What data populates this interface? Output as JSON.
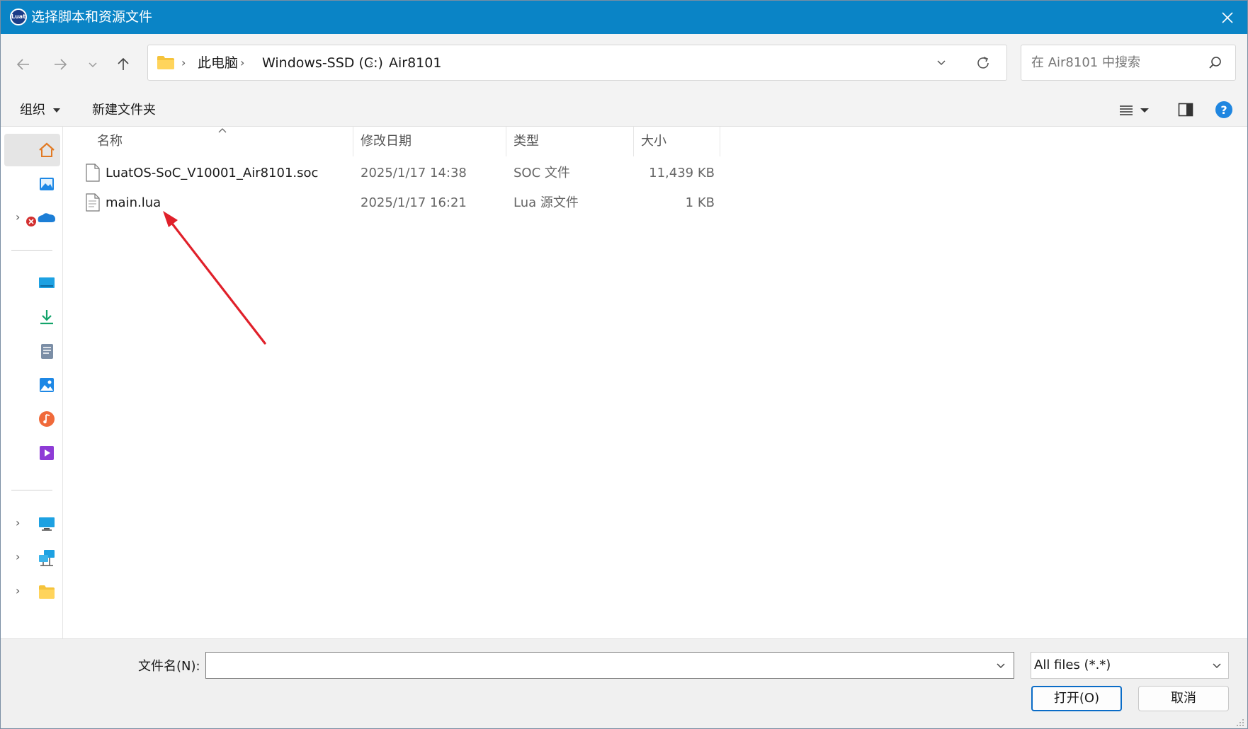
{
  "window": {
    "title": "选择脚本和资源文件",
    "app_icon_text": "Luat"
  },
  "address_bar": {
    "crumbs": [
      "此电脑",
      "Windows-SSD (C:)",
      "Air8101"
    ]
  },
  "search": {
    "placeholder": "在 Air8101 中搜索"
  },
  "toolbar": {
    "organize_label": "组织",
    "new_folder_label": "新建文件夹"
  },
  "columns": {
    "name": "名称",
    "modified": "修改日期",
    "type": "类型",
    "size": "大小"
  },
  "files": [
    {
      "name": "LuatOS-SoC_V10001_Air8101.soc",
      "modified": "2025/1/17 14:38",
      "type": "SOC 文件",
      "size": "11,439 KB"
    },
    {
      "name": "main.lua",
      "modified": "2025/1/17 16:21",
      "type": "Lua 源文件",
      "size": "1 KB"
    }
  ],
  "footer": {
    "filename_label": "文件名(N):",
    "filename_value": "",
    "filter_value": "All files (*.*)",
    "open_label": "打开(O)",
    "cancel_label": "取消"
  },
  "colors": {
    "titlebar": "#0a84c6",
    "annotation_arrow": "#e0202a",
    "primary_border": "#0a6cc7"
  }
}
